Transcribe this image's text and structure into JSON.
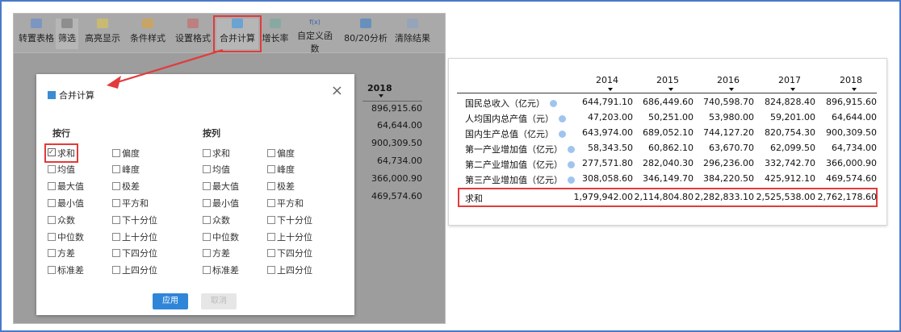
{
  "toolbar": {
    "items": [
      {
        "label": "转置表格",
        "icon": "transpose-icon"
      },
      {
        "label": "筛选",
        "icon": "filter-icon"
      },
      {
        "label": "高亮显示",
        "icon": "highlight-icon"
      },
      {
        "label": "条件样式",
        "icon": "conditional-style-icon"
      },
      {
        "label": "设置格式",
        "icon": "format-icon"
      },
      {
        "label": "合并计算",
        "icon": "merge-calc-icon"
      },
      {
        "label": "增长率",
        "icon": "growth-rate-icon"
      },
      {
        "label": "自定义函数",
        "icon": "custom-function-icon",
        "icon_text": "f(x)"
      },
      {
        "label": "80/20分析",
        "icon": "pareto-icon"
      },
      {
        "label": "清除结果",
        "icon": "clear-icon"
      }
    ]
  },
  "bg_table": {
    "year": "2018",
    "values": [
      "896,915.60",
      "64,644.00",
      "900,309.50",
      "64,734.00",
      "366,000.90",
      "469,574.60"
    ]
  },
  "dialog": {
    "title": "合并计算",
    "close_symbol": "×",
    "by_row_label": "按行",
    "by_col_label": "按列",
    "row_options": [
      {
        "label": "求和",
        "checked": true
      },
      {
        "label": "偏度",
        "checked": false
      },
      {
        "label": "均值",
        "checked": false
      },
      {
        "label": "峰度",
        "checked": false
      },
      {
        "label": "最大值",
        "checked": false
      },
      {
        "label": "极差",
        "checked": false
      },
      {
        "label": "最小值",
        "checked": false
      },
      {
        "label": "平方和",
        "checked": false
      },
      {
        "label": "众数",
        "checked": false
      },
      {
        "label": "下十分位",
        "checked": false
      },
      {
        "label": "中位数",
        "checked": false
      },
      {
        "label": "上十分位",
        "checked": false
      },
      {
        "label": "方差",
        "checked": false
      },
      {
        "label": "下四分位",
        "checked": false
      },
      {
        "label": "标准差",
        "checked": false
      },
      {
        "label": "上四分位",
        "checked": false
      }
    ],
    "col_options": [
      {
        "label": "求和",
        "checked": false
      },
      {
        "label": "偏度",
        "checked": false
      },
      {
        "label": "均值",
        "checked": false
      },
      {
        "label": "峰度",
        "checked": false
      },
      {
        "label": "最大值",
        "checked": false
      },
      {
        "label": "极差",
        "checked": false
      },
      {
        "label": "最小值",
        "checked": false
      },
      {
        "label": "平方和",
        "checked": false
      },
      {
        "label": "众数",
        "checked": false
      },
      {
        "label": "下十分位",
        "checked": false
      },
      {
        "label": "中位数",
        "checked": false
      },
      {
        "label": "上十分位",
        "checked": false
      },
      {
        "label": "方差",
        "checked": false
      },
      {
        "label": "下四分位",
        "checked": false
      },
      {
        "label": "标准差",
        "checked": false
      },
      {
        "label": "上四分位",
        "checked": false
      }
    ],
    "apply_label": "应用",
    "cancel_label": "取消"
  },
  "result_table": {
    "years": [
      "2014",
      "2015",
      "2016",
      "2017",
      "2018"
    ],
    "rows": [
      {
        "label": "国民总收入（亿元）",
        "values": [
          "644,791.10",
          "686,449.60",
          "740,598.70",
          "824,828.40",
          "896,915.60"
        ]
      },
      {
        "label": "人均国内总产值（元）",
        "values": [
          "47,203.00",
          "50,251.00",
          "53,980.00",
          "59,201.00",
          "64,644.00"
        ]
      },
      {
        "label": "国内生产总值（亿元）",
        "values": [
          "643,974.00",
          "689,052.10",
          "744,127.20",
          "820,754.30",
          "900,309.50"
        ]
      },
      {
        "label": "第一产业增加值（亿元）",
        "values": [
          "58,343.50",
          "60,862.10",
          "63,670.70",
          "62,099.50",
          "64,734.00"
        ]
      },
      {
        "label": "第二产业增加值（亿元）",
        "values": [
          "277,571.80",
          "282,040.30",
          "296,236.00",
          "332,742.70",
          "366,000.90"
        ]
      },
      {
        "label": "第三产业增加值（亿元）",
        "values": [
          "308,058.60",
          "346,149.70",
          "384,220.50",
          "425,912.10",
          "469,574.60"
        ]
      }
    ],
    "sum_row": {
      "label": "求和",
      "values": [
        "1,979,942.00",
        "2,114,804.80",
        "2,282,833.10",
        "2,525,538.00",
        "2,762,178.60"
      ]
    }
  },
  "colors": {
    "highlight_red": "#e23b3b",
    "apply_blue": "#2f86d8",
    "frame_blue": "#4a79c9"
  }
}
